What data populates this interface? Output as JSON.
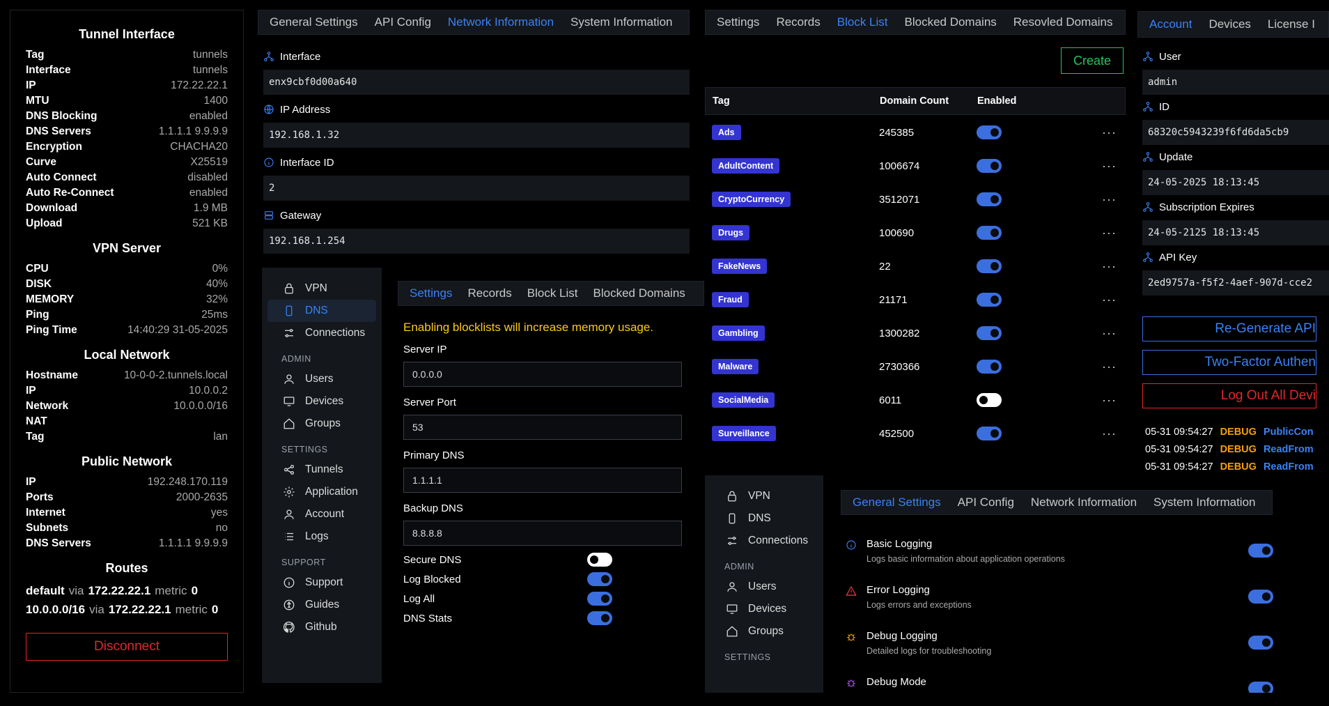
{
  "tunnel": {
    "interface_title": "Tunnel Interface",
    "interface_rows": [
      {
        "k": "Tag",
        "v": "tunnels"
      },
      {
        "k": "Interface",
        "v": "tunnels"
      },
      {
        "k": "IP",
        "v": "172.22.22.1"
      },
      {
        "k": "MTU",
        "v": "1400"
      },
      {
        "k": "DNS Blocking",
        "v": "enabled"
      },
      {
        "k": "DNS Servers",
        "v": "1.1.1.1 9.9.9.9"
      },
      {
        "k": "Encryption",
        "v": "CHACHA20"
      },
      {
        "k": "Curve",
        "v": "X25519"
      },
      {
        "k": "Auto Connect",
        "v": "disabled"
      },
      {
        "k": "Auto Re-Connect",
        "v": "enabled"
      },
      {
        "k": "Download",
        "v": "1.9 MB"
      },
      {
        "k": "Upload",
        "v": "521 KB"
      }
    ],
    "vpn_title": "VPN Server",
    "vpn_rows": [
      {
        "k": "CPU",
        "v": "0%"
      },
      {
        "k": "DISK",
        "v": "40%"
      },
      {
        "k": "MEMORY",
        "v": "32%"
      },
      {
        "k": "Ping",
        "v": "25ms"
      },
      {
        "k": "Ping Time",
        "v": "14:40:29 31-05-2025"
      }
    ],
    "local_title": "Local Network",
    "local_rows": [
      {
        "k": "Hostname",
        "v": "10-0-0-2.tunnels.local"
      },
      {
        "k": "IP",
        "v": "10.0.0.2"
      },
      {
        "k": "Network",
        "v": "10.0.0.0/16"
      },
      {
        "k": "NAT",
        "v": ""
      },
      {
        "k": "Tag",
        "v": "lan"
      }
    ],
    "public_title": "Public Network",
    "public_rows": [
      {
        "k": "IP",
        "v": "192.248.170.119"
      },
      {
        "k": "Ports",
        "v": "2000-2635"
      },
      {
        "k": "Internet",
        "v": "yes"
      },
      {
        "k": "Subnets",
        "v": "no"
      },
      {
        "k": "DNS Servers",
        "v": "1.1.1.1 9.9.9.9"
      }
    ],
    "routes_title": "Routes",
    "routes": [
      {
        "dest": "default",
        "via": "via",
        "gw": "172.22.22.1",
        "metric_label": "metric",
        "metric": "0"
      },
      {
        "dest": "10.0.0.0/16",
        "via": "via",
        "gw": "172.22.22.1",
        "metric_label": "metric",
        "metric": "0"
      }
    ],
    "disconnect_label": "Disconnect"
  },
  "net_panel": {
    "tabs": [
      "General Settings",
      "API Config",
      "Network Information",
      "System Information"
    ],
    "active_tab": 2,
    "fields": [
      {
        "label": "Interface",
        "value": "enx9cbf0d00a640",
        "icon": "network-icon"
      },
      {
        "label": "IP Address",
        "value": "192.168.1.32",
        "icon": "globe-icon"
      },
      {
        "label": "Interface ID",
        "value": "2",
        "icon": "info-icon"
      },
      {
        "label": "Gateway",
        "value": "192.168.1.254",
        "icon": "server-icon"
      }
    ]
  },
  "sidebar1": {
    "items_top": [
      {
        "label": "VPN",
        "icon": "lock-icon"
      },
      {
        "label": "DNS",
        "icon": "phone-icon",
        "active": true
      },
      {
        "label": "Connections",
        "icon": "sliders-icon"
      }
    ],
    "admin_head": "ADMIN",
    "items_admin": [
      {
        "label": "Users",
        "icon": "user-icon"
      },
      {
        "label": "Devices",
        "icon": "monitor-icon"
      },
      {
        "label": "Groups",
        "icon": "home-icon"
      }
    ],
    "settings_head": "SETTINGS",
    "items_settings": [
      {
        "label": "Tunnels",
        "icon": "share-icon"
      },
      {
        "label": "Application",
        "icon": "gear-icon"
      },
      {
        "label": "Account",
        "icon": "user-icon"
      },
      {
        "label": "Logs",
        "icon": "list-icon"
      }
    ],
    "support_head": "SUPPORT",
    "items_support": [
      {
        "label": "Support",
        "icon": "info-icon"
      },
      {
        "label": "Guides",
        "icon": "accessibility-icon"
      },
      {
        "label": "Github",
        "icon": "github-icon"
      }
    ]
  },
  "dns_panel": {
    "tabs": [
      "Settings",
      "Records",
      "Block List",
      "Blocked Domains"
    ],
    "active_tab": 0,
    "warning": "Enabling blocklists will increase memory usage.",
    "fields": [
      {
        "label": "Server IP",
        "value": "0.0.0.0"
      },
      {
        "label": "Server Port",
        "value": "53"
      },
      {
        "label": "Primary DNS",
        "value": "1.1.1.1"
      },
      {
        "label": "Backup DNS",
        "value": "8.8.8.8"
      }
    ],
    "toggles": [
      {
        "label": "Secure DNS",
        "on": false
      },
      {
        "label": "Log Blocked",
        "on": true
      },
      {
        "label": "Log All",
        "on": true
      },
      {
        "label": "DNS Stats",
        "on": true
      }
    ]
  },
  "blocklist_panel": {
    "tabs": [
      "Settings",
      "Records",
      "Block List",
      "Blocked Domains",
      "Resovled Domains"
    ],
    "active_tab": 2,
    "create_label": "Create",
    "headers": [
      "Tag",
      "Domain Count",
      "Enabled"
    ],
    "rows": [
      {
        "tag": "Ads",
        "count": "245385",
        "enabled": true
      },
      {
        "tag": "AdultContent",
        "count": "1006674",
        "enabled": true
      },
      {
        "tag": "CryptoCurrency",
        "count": "3512071",
        "enabled": true
      },
      {
        "tag": "Drugs",
        "count": "100690",
        "enabled": true
      },
      {
        "tag": "FakeNews",
        "count": "22",
        "enabled": true
      },
      {
        "tag": "Fraud",
        "count": "21171",
        "enabled": true
      },
      {
        "tag": "Gambling",
        "count": "1300282",
        "enabled": true
      },
      {
        "tag": "Malware",
        "count": "2730366",
        "enabled": true
      },
      {
        "tag": "SocialMedia",
        "count": "6011",
        "enabled": false
      },
      {
        "tag": "Surveillance",
        "count": "452500",
        "enabled": true
      }
    ],
    "more_glyph": "···"
  },
  "account_panel": {
    "tabs": [
      "Account",
      "Devices",
      "License I"
    ],
    "active_tab": 0,
    "fields": [
      {
        "label": "User",
        "value": "admin"
      },
      {
        "label": "ID",
        "value": "68320c5943239f6fd6da5cb9"
      },
      {
        "label": "Update",
        "value": "24-05-2025 18:13:45"
      },
      {
        "label": "Subscription Expires",
        "value": "24-05-2125 18:13:45"
      },
      {
        "label": "API Key",
        "value": "2ed9757a-f5f2-4aef-907d-cce2"
      }
    ],
    "regen_label": "Re-Generate API",
    "twofa_label": "Two-Factor Authen",
    "logout_label": "Log Out All Devi",
    "logs": [
      {
        "time": "05-31 09:54:27",
        "level": "DEBUG",
        "src": "PublicCon"
      },
      {
        "time": "05-31 09:54:27",
        "level": "DEBUG",
        "src": "ReadFrom"
      },
      {
        "time": "05-31 09:54:27",
        "level": "DEBUG",
        "src": "ReadFrom"
      }
    ]
  },
  "sidebar2": {
    "items_top": [
      {
        "label": "VPN",
        "icon": "lock-icon"
      },
      {
        "label": "DNS",
        "icon": "phone-icon"
      },
      {
        "label": "Connections",
        "icon": "sliders-icon"
      }
    ],
    "admin_head": "ADMIN",
    "items_admin": [
      {
        "label": "Users",
        "icon": "user-icon"
      },
      {
        "label": "Devices",
        "icon": "monitor-icon"
      },
      {
        "label": "Groups",
        "icon": "home-icon"
      }
    ],
    "settings_head": "SETTINGS"
  },
  "logging_panel": {
    "tabs": [
      "General Settings",
      "API Config",
      "Network Information",
      "System Information"
    ],
    "active_tab": 0,
    "items": [
      {
        "title": "Basic Logging",
        "desc": "Logs basic information about application operations",
        "icon": "info-icon",
        "color": "#3b82f6",
        "on": true
      },
      {
        "title": "Error Logging",
        "desc": "Logs errors and exceptions",
        "icon": "warning-icon",
        "color": "#ef4444",
        "on": true
      },
      {
        "title": "Debug Logging",
        "desc": "Detailed logs for troubleshooting",
        "icon": "bug-icon",
        "color": "#f59e0b",
        "on": true
      },
      {
        "title": "Debug Mode",
        "desc": "",
        "icon": "bug-icon",
        "color": "#a855f7",
        "on": true
      }
    ]
  },
  "colors": {
    "accent": "#3b82f6",
    "danger": "#e3262c",
    "warning": "#facc15",
    "create": "#22c55e",
    "debug": "#f59e0b"
  }
}
